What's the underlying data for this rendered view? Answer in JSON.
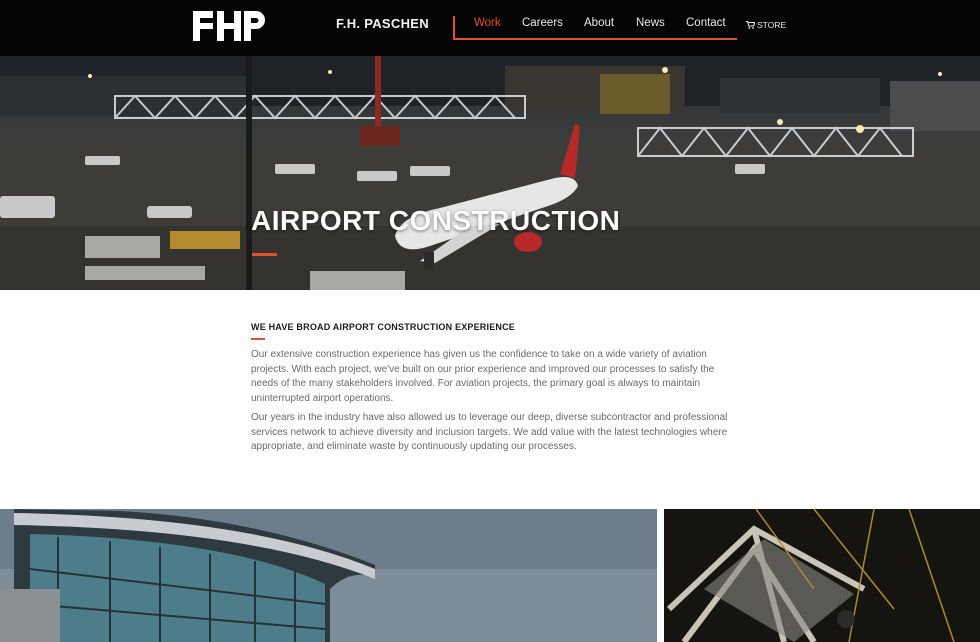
{
  "header": {
    "brand": "F.H. PASCHEN",
    "nav": [
      "Work",
      "Careers",
      "About",
      "News",
      "Contact"
    ],
    "active": "Work",
    "store_label": "STORE"
  },
  "hero": {
    "title": "AIRPORT CONSTRUCTION"
  },
  "section": {
    "heading": "WE HAVE BROAD AIRPORT CONSTRUCTION EXPERIENCE",
    "paragraphs": [
      "Our extensive construction experience has given us the confidence to take on a wide variety of aviation projects. With each project, we've built on our prior experience and improved our processes to satisfy the needs of the many stakeholders involved. For aviation projects, the primary goal is always to maintain uninterrupted airport operations.",
      "Our years in the industry have also allowed us to leverage our deep, diverse subcontractor and professional services network to achieve diversity and inclusion targets. We add value with the latest technologies where appropriate, and eliminate waste by continuously updating our processes."
    ]
  },
  "colors": {
    "accent": "#e0502a",
    "header_bg": "#050505"
  },
  "icons": [
    "fhp-logo",
    "cart-icon"
  ]
}
